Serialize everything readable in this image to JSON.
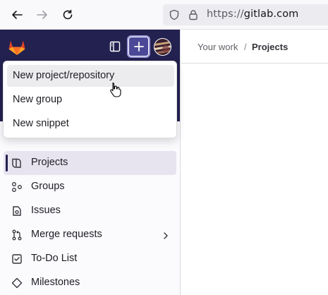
{
  "browser": {
    "url_prefix": "https://",
    "url_domain": "gitlab.com",
    "icons": [
      "back-arrow-icon",
      "forward-arrow-icon",
      "reload-icon",
      "shield-icon",
      "lock-icon"
    ]
  },
  "sidebar": {
    "icons": [
      "gitlab-logo-icon",
      "sidebar-toggle-icon",
      "plus-icon",
      "avatar"
    ],
    "items": [
      {
        "label": "Projects",
        "icon": "project-icon",
        "active": true
      },
      {
        "label": "Groups",
        "icon": "group-icon"
      },
      {
        "label": "Issues",
        "icon": "issues-icon"
      },
      {
        "label": "Merge requests",
        "icon": "merge-request-icon",
        "has_submenu": true
      },
      {
        "label": "To-Do List",
        "icon": "todo-icon"
      },
      {
        "label": "Milestones",
        "icon": "milestone-icon"
      }
    ]
  },
  "breadcrumb": {
    "items": [
      "Your work",
      "Projects"
    ],
    "separator": "/"
  },
  "new_menu": {
    "items": [
      {
        "label": "New project/repository",
        "hovered": true
      },
      {
        "label": "New group"
      },
      {
        "label": "New snippet"
      }
    ]
  },
  "colors": {
    "sidebar_header": "#232150",
    "accent_button": "#4b4997",
    "active_item_bg": "#e7e4f0",
    "logo_orange": "#e24329"
  }
}
